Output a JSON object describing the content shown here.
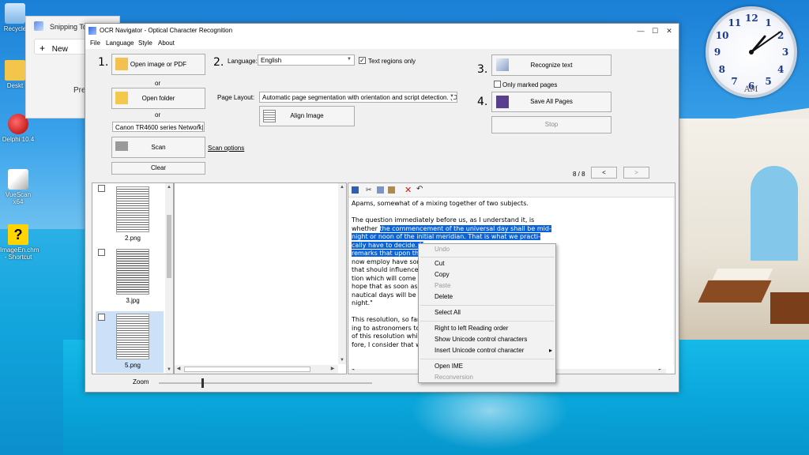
{
  "desktop": {
    "icons": [
      {
        "label": "Recycle"
      },
      {
        "label": "Deskt"
      },
      {
        "label": "Delphi 10.4"
      },
      {
        "label": "VueScan x64"
      },
      {
        "label": "ImageEn.chm - Shortcut"
      }
    ],
    "clock": {
      "numbers": [
        "12",
        "1",
        "2",
        "3",
        "4",
        "5",
        "6",
        "7",
        "8",
        "9",
        "10",
        "11"
      ],
      "ampm": "AM",
      "hour_hand_deg": -50,
      "minute_hand_deg": -35
    }
  },
  "snipping_tool": {
    "title": "Snipping To",
    "new_label": "New",
    "new_icon": "plus-icon",
    "pre_text": "Pre"
  },
  "window": {
    "title": "OCR Navigator - Optical Character Recognition",
    "controls": {
      "minimize": "—",
      "maximize": "☐",
      "close": "✕"
    },
    "menu": [
      "File",
      "Language",
      "Style",
      "About"
    ]
  },
  "steps": {
    "s1": "1.",
    "s2": "2.",
    "s3": "3.",
    "s4": "4."
  },
  "left_controls": {
    "open_image": "Open image or PDF",
    "or1": "or",
    "open_folder": "Open folder",
    "or2": "or",
    "scanner": "Canon TR4600 series Network|",
    "scan": "Scan",
    "scan_options": "Scan options",
    "clear": "Clear"
  },
  "language": {
    "label": "Language:",
    "value": "English",
    "text_regions_label": "Text regions only",
    "text_regions_checked": true
  },
  "page_layout": {
    "label": "Page Layout:",
    "value": "Automatic page segmentation with orientation and script detection. (OSD)"
  },
  "align_image": "Align Image",
  "right_controls": {
    "recognize": "Recognize text",
    "only_marked": "Only marked pages",
    "save_all": "Save All Pages",
    "stop": "Stop"
  },
  "pager": {
    "count": "8 / 8",
    "prev": "<",
    "next": ">"
  },
  "thumbnails": [
    {
      "label": "2.png",
      "checked": false
    },
    {
      "label": "3.jpg",
      "checked": false
    },
    {
      "label": "5.png",
      "checked": false
    }
  ],
  "zoom_label": "Zoom",
  "text_lines": [
    {
      "pre": "Apams, somewhat of a mixing together of two subjects.",
      "sel": "",
      "post": ""
    },
    {
      "pre": "",
      "sel": "",
      "post": ""
    },
    {
      "pre": "The question immediately before us, as I understand it, is",
      "sel": "",
      "post": ""
    },
    {
      "pre": "whether ",
      "sel": "the commencement of the universal day shall be mid-",
      "post": ""
    },
    {
      "pre": "",
      "sel": "night or noon of the initial meridian. That is what we practi-",
      "post": ""
    },
    {
      "pre": "",
      "sel": "cally have to decide. N",
      "post": ""
    },
    {
      "pre": "",
      "sel": "remarks that upon this",
      "post": ""
    },
    {
      "pre": "now employ have som",
      "sel": "",
      "post": ""
    },
    {
      "pre": "that should influence u",
      "sel": "",
      "post": ""
    },
    {
      "pre": "tion which will come b",
      "sel": "",
      "post": ""
    },
    {
      "pre": "hope that as soon as m",
      "sel": "",
      "post": ""
    },
    {
      "pre": "nautical days will be ar",
      "sel": "",
      "post": ""
    },
    {
      "pre": "night.\"",
      "sel": "",
      "post": ""
    },
    {
      "pre": "",
      "sel": "",
      "post": ""
    },
    {
      "pre": "This resolution, so far",
      "sel": "",
      "post": ""
    },
    {
      "pre": "ing to astronomers to",
      "sel": "",
      "post": ""
    },
    {
      "pre": "of this resolution which",
      "sel": "",
      "post": ""
    },
    {
      "pre": "fore, I consider that we",
      "sel": "",
      "post": ""
    }
  ],
  "context_menu": [
    {
      "label": "Undo",
      "disabled": true
    },
    {
      "label": "Cut",
      "disabled": false
    },
    {
      "label": "Copy",
      "disabled": false
    },
    {
      "label": "Paste",
      "disabled": true
    },
    {
      "label": "Delete",
      "disabled": false
    },
    {
      "label": "Select All",
      "disabled": false
    },
    {
      "label": "Right to left Reading order",
      "disabled": false
    },
    {
      "label": "Show Unicode control characters",
      "disabled": false
    },
    {
      "label": "Insert Unicode control character",
      "disabled": false,
      "submenu_arrow": "▸"
    },
    {
      "label": "Open IME",
      "disabled": false
    },
    {
      "label": "Reconversion",
      "disabled": true
    }
  ]
}
